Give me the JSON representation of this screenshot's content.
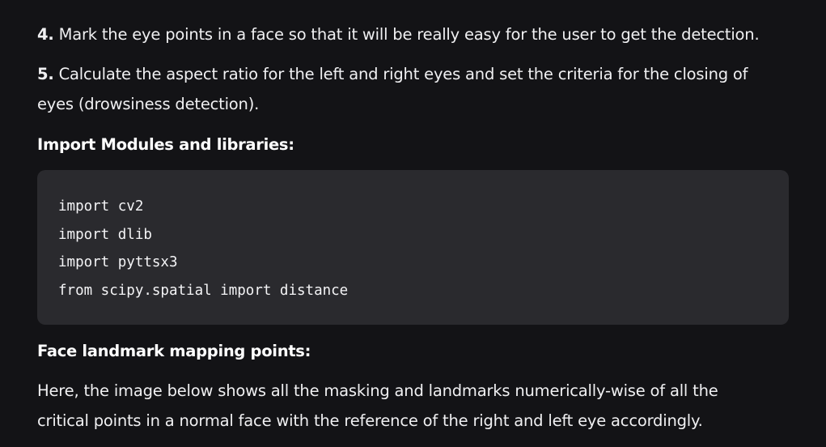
{
  "steps": [
    {
      "number": "4.",
      "text": "Mark the eye points in a face so that it will be really easy for the user to get the detection."
    },
    {
      "number": "5.",
      "text": "Calculate the aspect ratio for the left and right eyes and set the criteria for the closing of eyes (drowsiness detection)."
    }
  ],
  "import_section": {
    "heading": "Import Modules and libraries:",
    "code_lines": [
      "import cv2",
      "import dlib",
      "import pyttsx3",
      "from scipy.spatial import distance"
    ]
  },
  "landmark_section": {
    "heading": "Face landmark mapping points:",
    "paragraph": "Here, the image below shows all the masking and landmarks numerically-wise of all the critical points in a normal face with the reference of the right and left eye accordingly."
  }
}
